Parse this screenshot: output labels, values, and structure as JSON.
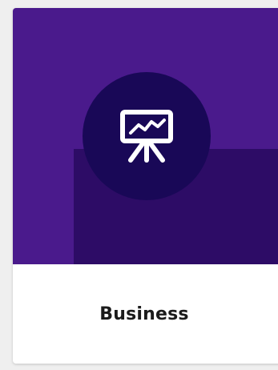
{
  "card": {
    "label": "Business",
    "icon": "presentation-chart-icon",
    "colors": {
      "hero_background": "#4a1a8c",
      "hero_shape": "#2d0c66",
      "icon_circle": "#190857",
      "icon_color": "#ffffff",
      "label_color": "#1b1b1b"
    }
  }
}
